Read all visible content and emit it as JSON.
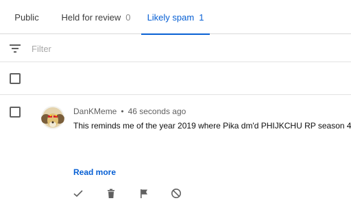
{
  "tabs": [
    {
      "label": "Public",
      "count": ""
    },
    {
      "label": "Held for review",
      "count": "0"
    },
    {
      "label": "Likely spam",
      "count": "1"
    }
  ],
  "filter": {
    "placeholder": "Filter",
    "icon": "filter-icon"
  },
  "comment": {
    "author": "DanKMeme",
    "separator": "•",
    "time": "46 seconds ago",
    "text": "This reminds me of the year 2019 where Pika dm'd PHIJKCHU RP season 4.",
    "read_more": "Read more",
    "actions": [
      "check-icon",
      "trash-icon",
      "flag-icon",
      "block-icon"
    ]
  },
  "colors": {
    "accent": "#065fd4",
    "icon": "#606060"
  }
}
